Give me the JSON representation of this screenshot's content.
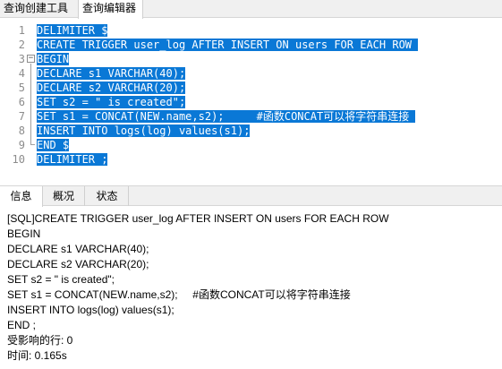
{
  "top_tabs": [
    "查询创建工具",
    "查询编辑器"
  ],
  "editor": {
    "lines": [
      {
        "num": "1",
        "text": "DELIMITER $"
      },
      {
        "num": "2",
        "text": "CREATE TRIGGER user_log AFTER INSERT ON users FOR EACH ROW "
      },
      {
        "num": "3",
        "text": "BEGIN"
      },
      {
        "num": "4",
        "text": "DECLARE s1 VARCHAR(40);"
      },
      {
        "num": "5",
        "text": "DECLARE s2 VARCHAR(20);"
      },
      {
        "num": "6",
        "text": "SET s2 = \" is created\";"
      },
      {
        "num": "7",
        "text": "SET s1 = CONCAT(NEW.name,s2);     #函数CONCAT可以将字符串连接 "
      },
      {
        "num": "8",
        "text": "INSERT INTO logs(log) values(s1);"
      },
      {
        "num": "9",
        "text": "END $"
      },
      {
        "num": "10",
        "text": "DELIMITER ;"
      }
    ],
    "fold_marker": "−"
  },
  "result_tabs": [
    "信息",
    "概况",
    "状态"
  ],
  "result": {
    "lines": [
      "[SQL]CREATE TRIGGER user_log AFTER INSERT ON users FOR EACH ROW",
      "BEGIN",
      "DECLARE s1 VARCHAR(40);",
      "DECLARE s2 VARCHAR(20);",
      "SET s2 = \" is created\";",
      "SET s1 = CONCAT(NEW.name,s2);     #函数CONCAT可以将字符串连接",
      "INSERT INTO logs(log) values(s1);",
      "END ;",
      "受影响的行: 0",
      "时间: 0.165s"
    ]
  },
  "colors": {
    "selection": "#0a78d6",
    "line_number": "#8c8c8c",
    "tab_bar": "#f0f0f0"
  }
}
